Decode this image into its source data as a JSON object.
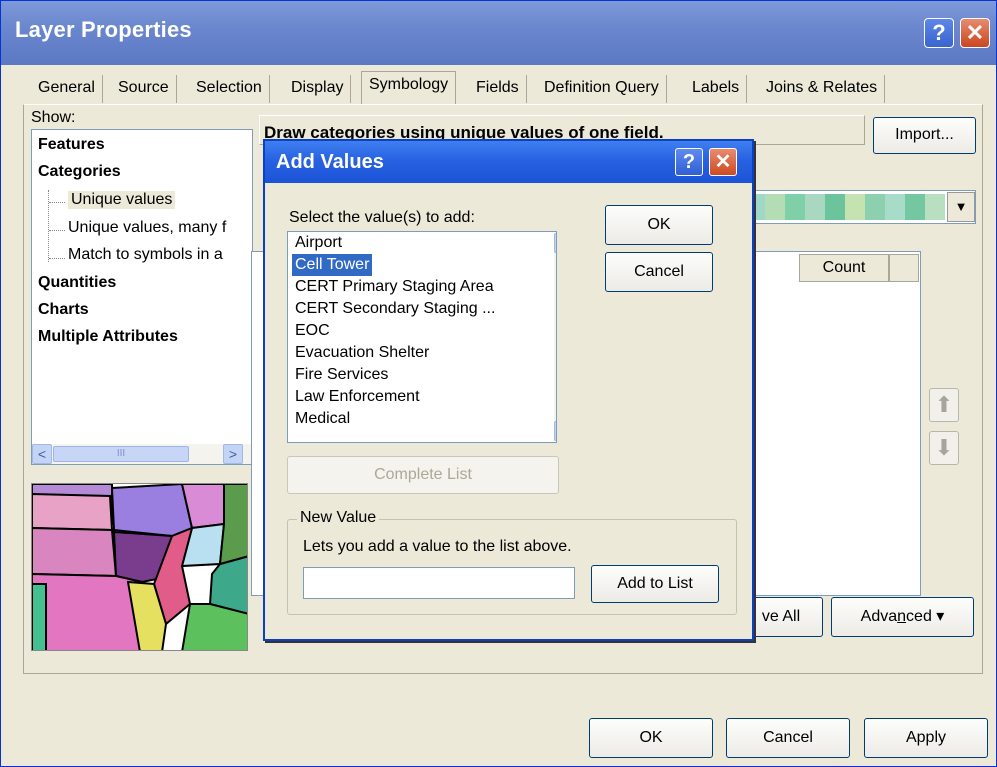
{
  "window": {
    "title": "Layer Properties",
    "help_glyph": "?",
    "close_glyph": "✕"
  },
  "tabs": [
    "General",
    "Source",
    "Selection",
    "Display",
    "Symbology",
    "Fields",
    "Definition Query",
    "Labels",
    "Joins & Relates"
  ],
  "active_tab": "Symbology",
  "show": {
    "label": "Show:",
    "items": [
      {
        "label": "Features",
        "bold": true
      },
      {
        "label": "Categories",
        "bold": true
      },
      {
        "label": "Unique values",
        "bold": false,
        "selected": true
      },
      {
        "label": "Unique values, many f",
        "bold": false
      },
      {
        "label": "Match to symbols in a",
        "bold": false
      },
      {
        "label": "Quantities",
        "bold": true
      },
      {
        "label": "Charts",
        "bold": true
      },
      {
        "label": "Multiple Attributes",
        "bold": true
      }
    ]
  },
  "scroll": {
    "left": "<",
    "right": ">",
    "grip": "III",
    "up": "▲",
    "down": "▼"
  },
  "symbology": {
    "description": "Draw categories using unique values of one field.",
    "import_label": "Import...",
    "count_header": "Count",
    "ramp_dropdown": "▼",
    "ramp_colors": [
      "#9fd8c8",
      "#b5ddb4",
      "#7fcfa8",
      "#a8d8c0",
      "#6cc49c",
      "#c5e3b1",
      "#8dd0b0",
      "#a7dcc9",
      "#74c7a0",
      "#b8e0c0"
    ],
    "up_arrow": "⬆",
    "down_arrow": "⬇",
    "remove_all_label": "ve All",
    "advanced_label_pre": "Adva",
    "advanced_label_u": "n",
    "advanced_label_post": "ced",
    "advanced_caret": "▾"
  },
  "footer": {
    "ok": "OK",
    "cancel": "Cancel",
    "apply": "Apply"
  },
  "add_values": {
    "title": "Add Values",
    "select_label": "Select the value(s) to add:",
    "values": [
      "Airport",
      "Cell Tower",
      "CERT Primary Staging Area",
      "CERT Secondary Staging ...",
      "EOC",
      "Evacuation Shelter",
      "Fire Services",
      "Law Enforcement",
      "Medical"
    ],
    "selected_value": "Cell Tower",
    "ok": "OK",
    "cancel": "Cancel",
    "complete_list": "Complete List",
    "new_value_legend": "New Value",
    "new_value_hint": "Lets you add a value to the list above.",
    "new_value_input": "",
    "add_to_list": "Add to List"
  }
}
